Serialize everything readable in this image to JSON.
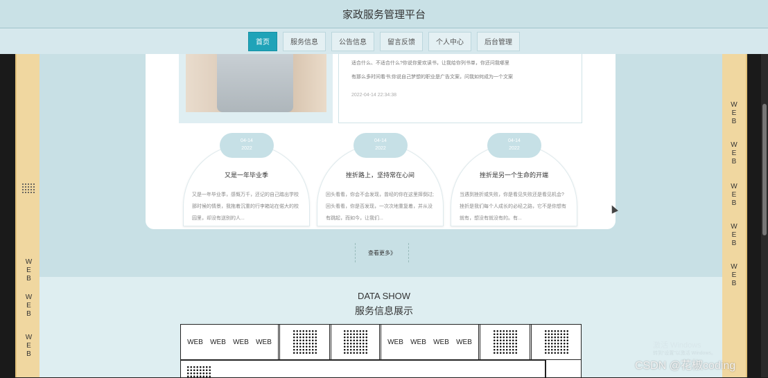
{
  "header": {
    "title": "家政服务管理平台"
  },
  "nav": {
    "items": [
      {
        "label": "首页",
        "active": true
      },
      {
        "label": "服务信息"
      },
      {
        "label": "公告信息"
      },
      {
        "label": "留言反馈"
      },
      {
        "label": "个人中心"
      },
      {
        "label": "后台管理"
      }
    ]
  },
  "feature": {
    "line1": "适合什么、不适合什么?你说你爱欢读书，让我给你列书单，你还问我哪里",
    "line2": "有那么多时间看书;你说自己梦想的职业是广告文案，问我如何成为一个文案",
    "date": "2022-04-14 22:34:38"
  },
  "cards": [
    {
      "date1": "04-14",
      "date2": "2022",
      "title": "又是一年毕业季",
      "body": "又是一年毕业季，感慨万千，还记的自己踏出学校那时候的情景，我拖着沉重的行李箱站在偌大的校园里，却没有送别的人..."
    },
    {
      "date1": "04-14",
      "date2": "2022",
      "title": "挫折路上，坚持常在心间",
      "body": "回头看看，你会不会发现，曾经的你在这里摔倒过;回头看看，你是否发现，一次次地重复着，并从没有跳起，而如今，让我们..."
    },
    {
      "date1": "04-14",
      "date2": "2022",
      "title": "挫折是另一个生命的开端",
      "body": "当遇到挫折或失败，你是看见失败还是看见机会?挫折是我们每个人成长的必经之路，它不是你想有就有，想没有就没有的。有..."
    }
  ],
  "more": {
    "label": "查看更多》"
  },
  "section": {
    "en": "DATA SHOW",
    "cn": "服务信息展示"
  },
  "grid": {
    "web": "WEB"
  },
  "sidebar": {
    "vertical_text": "W\nE\nB"
  },
  "watermark": {
    "text": "CSDN @花椒coding",
    "activate": "激活 Windows",
    "activate_sub": "转到“设置”以激活 Windows。"
  },
  "colors": {
    "accent": "#1fa3b8",
    "header_bg": "#c9e1e6",
    "side_bg": "#f0d7a0",
    "card_pill": "#c6e0e6"
  }
}
